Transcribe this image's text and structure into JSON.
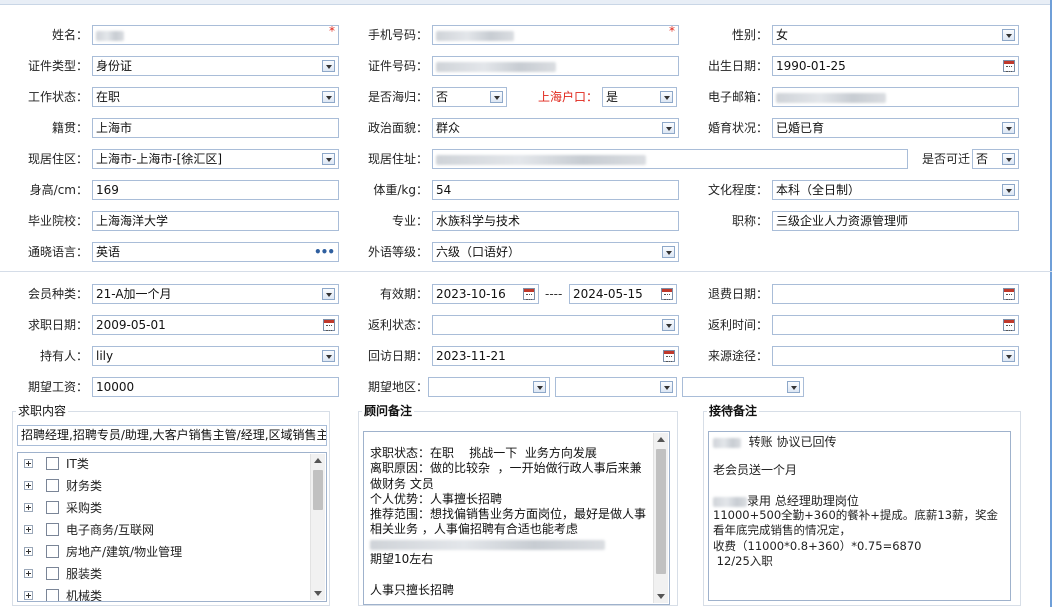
{
  "row1": {
    "name": {
      "label": "姓名："
    },
    "phone": {
      "label": "手机号码："
    },
    "gender": {
      "label": "性别：",
      "value": "女"
    }
  },
  "row2": {
    "id_type": {
      "label": "证件类型：",
      "value": "身份证"
    },
    "id_number": {
      "label": "证件号码："
    },
    "birth": {
      "label": "出生日期：",
      "value": "1990-01-25"
    }
  },
  "row3": {
    "work_status": {
      "label": "工作状态：",
      "value": "在职"
    },
    "returnee": {
      "label": "是否海归：",
      "value": "否"
    },
    "sh_hukou": {
      "label": "上海户口：",
      "value": "是"
    },
    "email": {
      "label": "电子邮箱："
    }
  },
  "row4": {
    "native": {
      "label": "籍贯：",
      "value": "上海市"
    },
    "politics": {
      "label": "政治面貌：",
      "value": "群众"
    },
    "marital": {
      "label": "婚育状况：",
      "value": "已婚已育"
    }
  },
  "row5": {
    "residence_area": {
      "label": "现居住区：",
      "value": "上海市-上海市-[徐汇区]"
    },
    "address": {
      "label": "现居住址："
    },
    "relocate": {
      "label": "是否可迁",
      "value": "否"
    }
  },
  "row6": {
    "height": {
      "label": "身高/cm：",
      "value": "169"
    },
    "weight": {
      "label": "体重/kg：",
      "value": "54"
    },
    "education": {
      "label": "文化程度：",
      "value": "本科（全日制）"
    }
  },
  "row7": {
    "school": {
      "label": "毕业院校：",
      "value": "上海海洋大学"
    },
    "major": {
      "label": "专业：",
      "value": "水族科学与技术"
    },
    "title": {
      "label": "职称：",
      "value": "三级企业人力资源管理师"
    }
  },
  "row8": {
    "language": {
      "label": "通晓语言：",
      "value": "英语"
    },
    "lang_level": {
      "label": "外语等级：",
      "value": "六级（口语好）"
    }
  },
  "row9": {
    "member_type": {
      "label": "会员种类：",
      "value": "21-A加一个月"
    },
    "validity": {
      "label": "有效期：",
      "start": "2023-10-16",
      "dash": "----",
      "end": "2024-05-15"
    },
    "refund_date": {
      "label": "退费日期："
    }
  },
  "row10": {
    "job_date": {
      "label": "求职日期：",
      "value": "2009-05-01"
    },
    "rebate_status": {
      "label": "返利状态："
    },
    "rebate_time": {
      "label": "返利时间："
    }
  },
  "row11": {
    "holder": {
      "label": "持有人：",
      "value": "lily"
    },
    "visit_date": {
      "label": "回访日期：",
      "value": "2023-11-21"
    },
    "source": {
      "label": "来源途径："
    }
  },
  "row12": {
    "salary": {
      "label": "期望工资：",
      "value": "10000"
    },
    "region": {
      "label": "期望地区："
    }
  },
  "job_content": {
    "title": "求职内容",
    "summary": "招聘经理,招聘专员/助理,大客户销售主管/经理,区域销售主",
    "categories": [
      "IT类",
      "财务类",
      "采购类",
      "电子商务/互联网",
      "房地产/建筑/物业管理",
      "服装类",
      "机械类"
    ]
  },
  "consultant_notes": {
    "title": "顾问备注",
    "text": "求职状态：在职    挑战一下  业务方向发展\n离职原因：做的比较杂  ，一开始做行政人事后来兼做财务 文员\n个人优势：人事擅长招聘\n推荐范围：想找偏销售业务方面岗位，最好是做人事相关业务 ，人事偏招聘有合适也能考虑",
    "text2": "期望10左右\n\n人事只擅长招聘"
  },
  "reception_notes": {
    "title": "接待备注",
    "line1": "转账  协议已回传",
    "line2": "老会员送一个月",
    "line3": "录用 总经理助理岗位",
    "line4": "11000+500全勤+360的餐补+提成。底薪13薪，奖金看年底完成销售的情况定，",
    "line5": "收费（11000*0.8+360）*0.75=6870",
    "line6": " 12/25入职"
  }
}
